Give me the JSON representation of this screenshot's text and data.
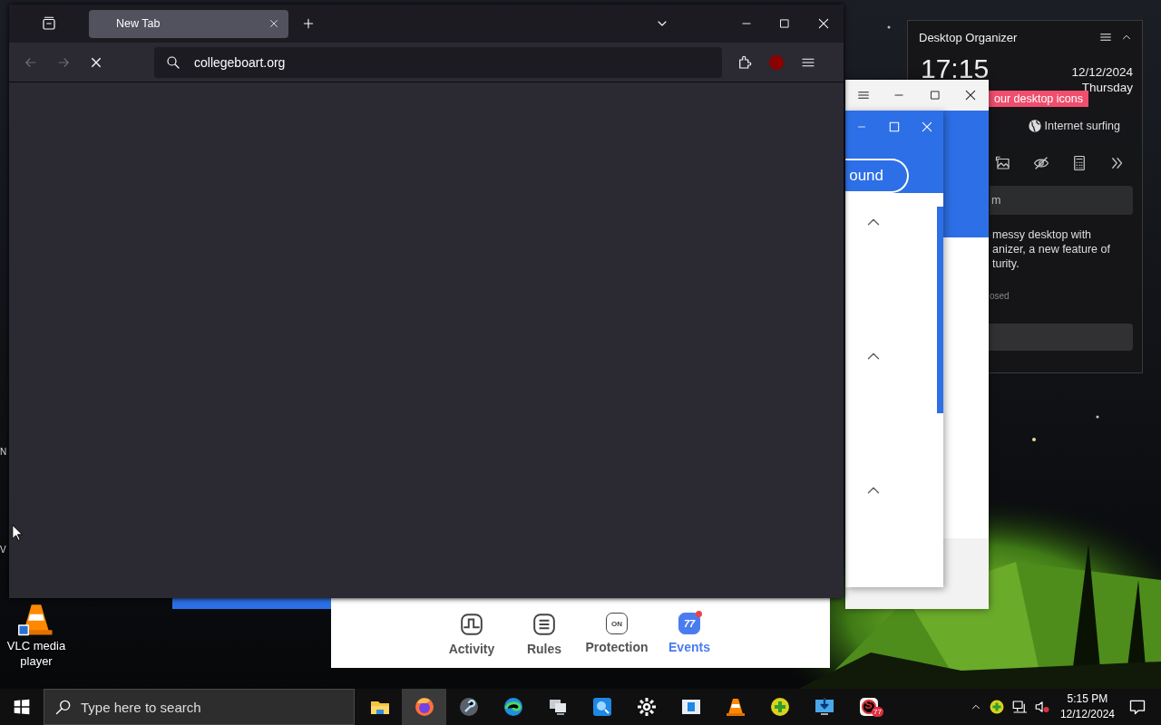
{
  "browser": {
    "tabs": [
      {
        "label": "New Tab",
        "selected": true
      }
    ],
    "can_go_back": false,
    "can_go_forward": false,
    "loading": true,
    "address": "collegeboart.org"
  },
  "organizer": {
    "title": "Desktop Organizer",
    "time": "17:15",
    "date": "12/12/2024",
    "weekday": "Thursday",
    "banner": "our desktop icons",
    "mode": "Internet surfing",
    "search_text": "m",
    "description": [
      "messy desktop with",
      "anizer, a new feature of",
      "turity."
    ],
    "note": "osed"
  },
  "security_app": {
    "button": "ound",
    "nav": [
      {
        "label": "Activity",
        "kind": "activity",
        "selected": false
      },
      {
        "label": "Rules",
        "kind": "rules",
        "selected": false
      },
      {
        "label": "Protection",
        "kind": "protection",
        "selected": false,
        "icon_text": "ON"
      },
      {
        "label": "Events",
        "kind": "events",
        "selected": true,
        "badge": "77"
      }
    ]
  },
  "desktop": {
    "label_fragments": [
      "N",
      "V"
    ],
    "icons": [
      {
        "label": "VLC media player"
      }
    ]
  },
  "taskbar": {
    "search": {
      "placeholder": "Type here to search"
    },
    "apps": [
      {
        "kind": "folder",
        "active": false
      },
      {
        "kind": "browser",
        "active": true
      },
      {
        "kind": "wrench",
        "active": false
      },
      {
        "kind": "swirl",
        "active": false
      },
      {
        "kind": "computers",
        "active": false
      },
      {
        "kind": "magnifier",
        "active": false
      },
      {
        "kind": "gear",
        "active": false
      },
      {
        "kind": "panel",
        "active": false
      },
      {
        "kind": "cone",
        "active": false
      },
      {
        "kind": "plus",
        "active": false
      },
      {
        "kind": "download",
        "active": false
      },
      {
        "kind": "letter",
        "active": false,
        "glyph": "S",
        "badge": "77"
      }
    ],
    "clock": {
      "time": "5:15 PM",
      "date": "12/12/2024"
    }
  }
}
